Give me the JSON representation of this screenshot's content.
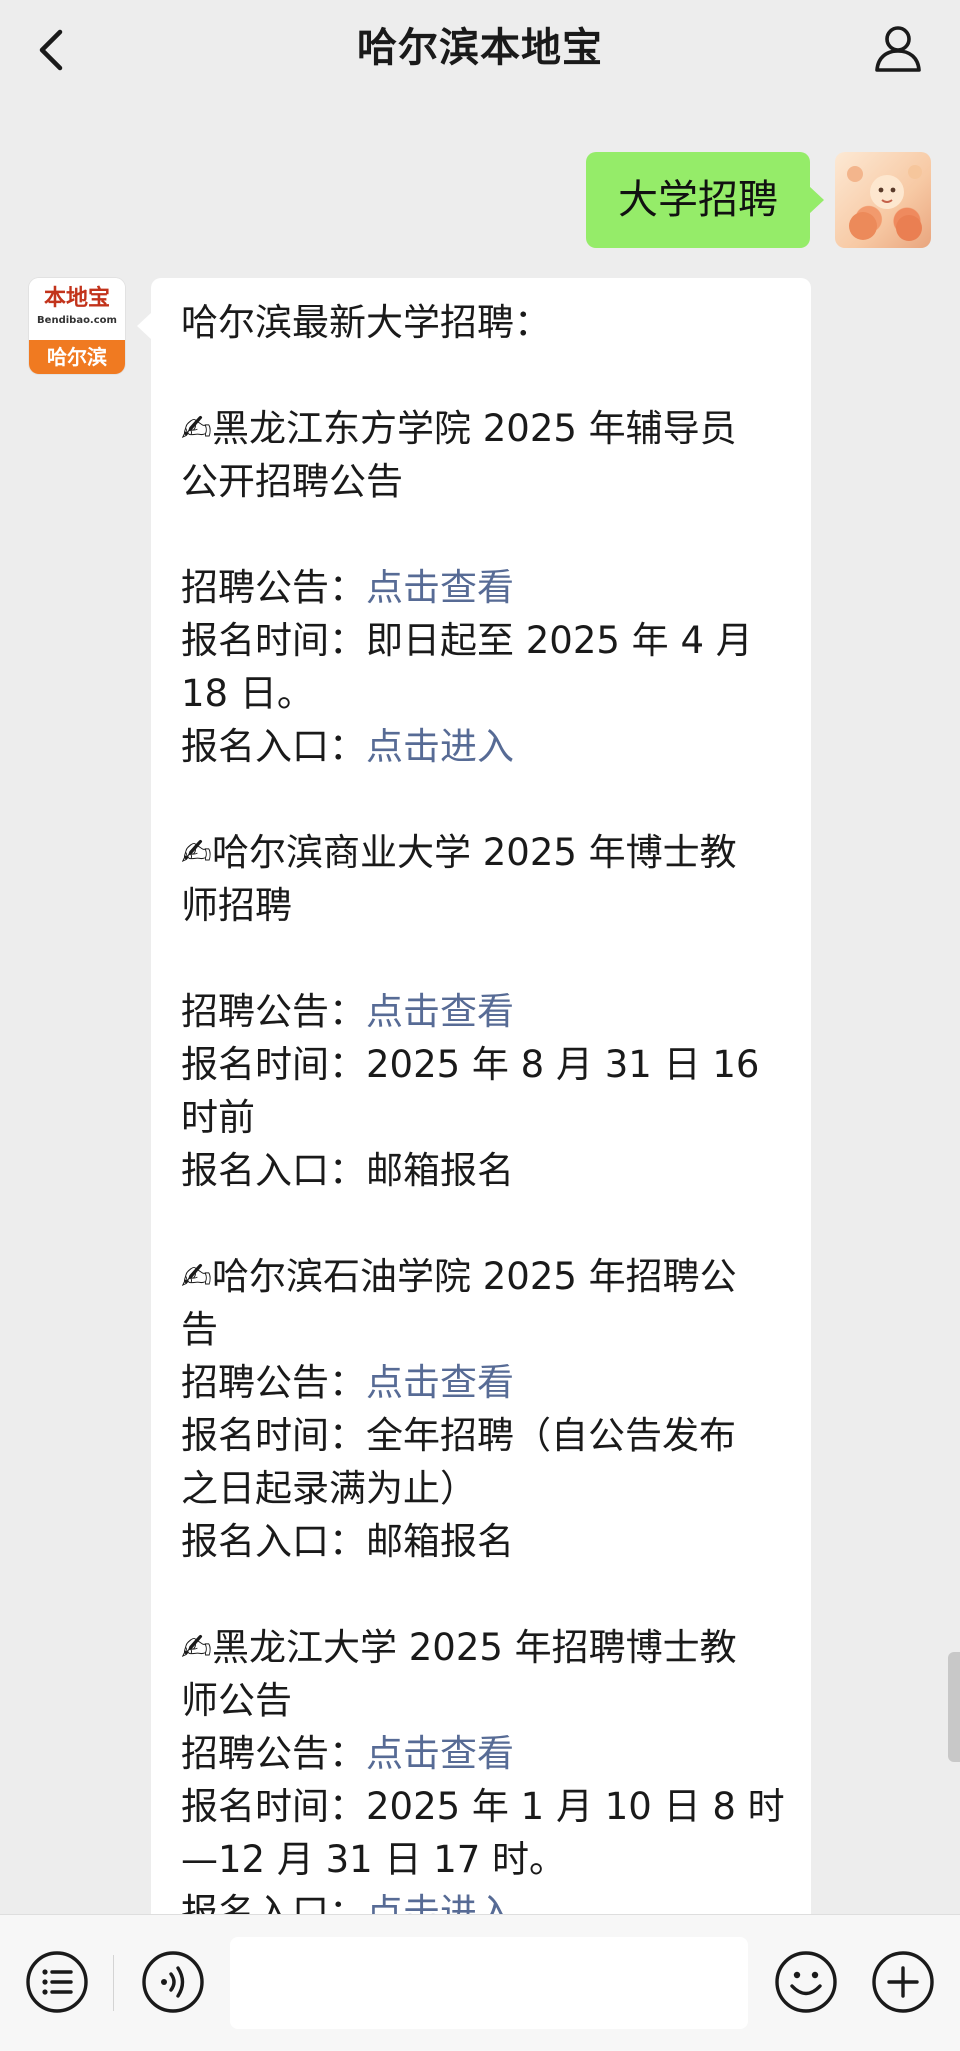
{
  "header": {
    "title": "哈尔滨本地宝",
    "back_icon": "chevron-left-icon",
    "profile_icon": "person-icon"
  },
  "my_message": {
    "text": "大学招聘"
  },
  "bot": {
    "avatar": {
      "logo_text": "本地宝",
      "logo_sub": "Bendibao.com",
      "city": "哈尔滨"
    },
    "message": {
      "intro": "哈尔滨最新大学招聘：",
      "items": [
        {
          "title_lines": [
            "✍黑龙江东方学院 2025 年辅导员",
            "公开招聘公告"
          ],
          "notice_label": "招聘公告：",
          "notice_link": "点击查看",
          "time_label": "报名时间：",
          "time_lines": [
            "即日起至 2025 年 4 月",
            "18 日。"
          ],
          "entry_label": "报名入口：",
          "entry_value": "点击进入"
        },
        {
          "title_lines": [
            "✍哈尔滨商业大学 2025 年博士教",
            "师招聘"
          ],
          "notice_label": "招聘公告：",
          "notice_link": "点击查看",
          "time_label": "报名时间：",
          "time_lines": [
            "2025 年 8 月 31 日 16",
            "时前"
          ],
          "entry_label": "报名入口：",
          "entry_value": "邮箱报名"
        },
        {
          "title_lines": [
            "✍哈尔滨石油学院 2025 年招聘公",
            "告"
          ],
          "notice_label": "招聘公告：",
          "notice_link": "点击查看",
          "time_label": "报名时间：",
          "time_lines": [
            "全年招聘（自公告发布",
            "之日起录满为止）"
          ],
          "entry_label": "报名入口：",
          "entry_value": "邮箱报名"
        },
        {
          "title_lines": [
            "✍黑龙江大学 2025 年招聘博士教",
            "师公告"
          ],
          "notice_label": "招聘公告：",
          "notice_link": "点击查看",
          "time_label": "报名时间：",
          "time_lines": [
            "2025 年 1 月 10 日 8 时",
            "—12 月 31 日 17 时。"
          ],
          "entry_label": "报名入口：",
          "entry_value": "点击进入"
        }
      ]
    }
  },
  "input_bar": {
    "menu_icon": "menu-list-icon",
    "voice_icon": "voice-icon",
    "emoji_icon": "emoji-icon",
    "plus_icon": "plus-icon",
    "text_value": ""
  },
  "colors": {
    "background": "#ededed",
    "my_bubble": "#95ec69",
    "link": "#576b95",
    "brand_orange": "#f07a21"
  }
}
